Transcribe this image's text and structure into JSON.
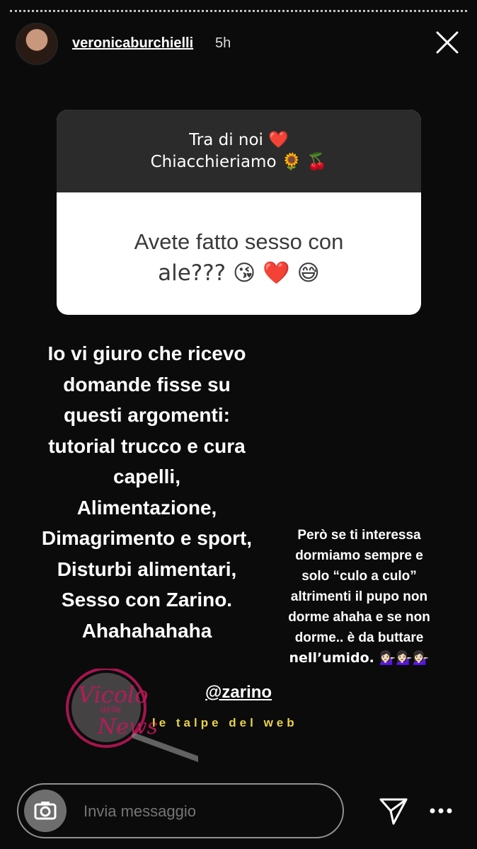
{
  "header": {
    "username": "veronicaburchielli",
    "time": "5h"
  },
  "question_box": {
    "title_line1": "Tra di noi ❤️",
    "title_line2": "Chiacchieriamo 🌻 🍒",
    "question_line1": "Avete fatto sesso con",
    "question_line2": "ale??? 😘 ❤️ 😅"
  },
  "main_text": [
    "Io vi giuro che ricevo",
    "domande fisse su",
    "questi argomenti:",
    "tutorial trucco e cura",
    "capelli,",
    "Alimentazione,",
    "Dimagrimento e sport,",
    "Disturbi alimentari,",
    "Sesso con Zarino.",
    "Ahahahahaha"
  ],
  "side_text": [
    "Però se ti interessa",
    "dormiamo sempre e",
    "solo “culo a culo”",
    "altrimenti il pupo non",
    "dorme ahaha e se non",
    "dorme.. è da buttare",
    "nell’umido. 💁🏻‍♀️💁🏻‍♀️💁🏻‍♀️"
  ],
  "mention": "@zarino",
  "watermark": {
    "vicolo_text": "Vicolo delle News",
    "talpe_text": "le talpe del web"
  },
  "message_bar": {
    "placeholder": "Invia messaggio"
  },
  "icons": {
    "close": "close-icon",
    "camera": "camera-icon",
    "send": "send-icon",
    "more": "more-icon"
  }
}
